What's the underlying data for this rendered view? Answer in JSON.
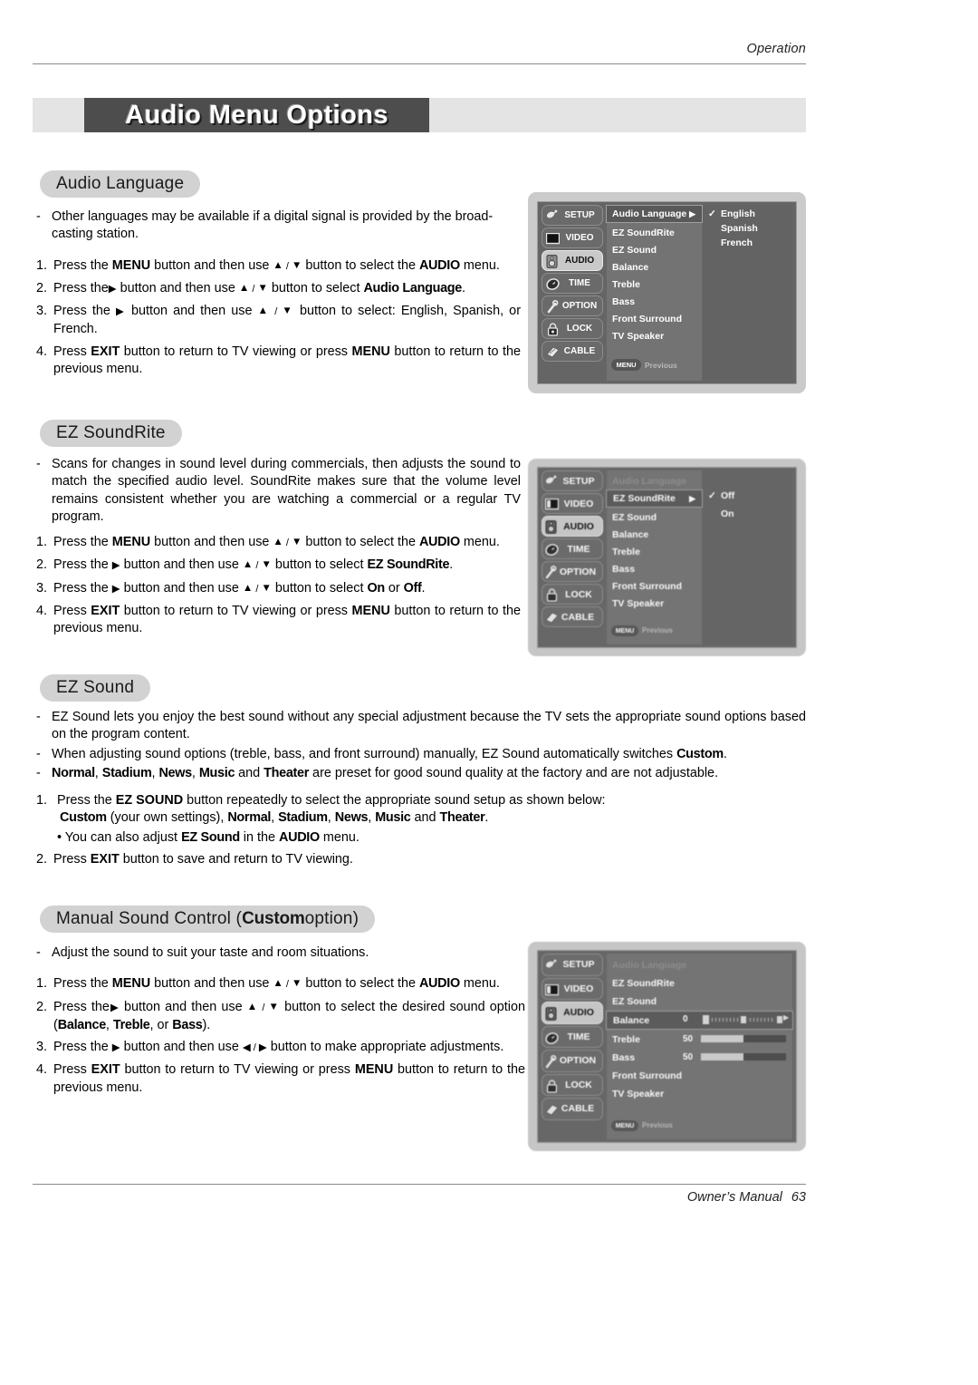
{
  "header": {
    "running_head": "Operation"
  },
  "title_banner": {
    "text": "Audio Menu Options"
  },
  "footer": {
    "manual_label": "Owner’s Manual",
    "page_number": "63"
  },
  "colors": {
    "banner_bg": "#e4e4e4",
    "banner_dark": "#4d4d4d",
    "pill_bg": "#d2d2d2",
    "osd_frame": "#cbcbcb",
    "osd_body": "#656565",
    "osd_selected": "#c9c9c9"
  },
  "sections": [
    {
      "id": "audio-language",
      "heading": "Audio Language",
      "bullets": [
        "Other languages may be available if a digital signal is provided by the broad-casting station."
      ],
      "steps": [
        "1. Press the MENU button and then use ▲ / ▼ button to select the AUDIO menu.",
        "2. Press the ▶ button and then use ▲ / ▼ button to select Audio Language.",
        "3. Press the ▶ button and then use ▲ / ▼ button to select: English, Spanish, or French.",
        "4. Press EXIT button to return to TV viewing or press MENU button to return to the previous menu."
      ]
    },
    {
      "id": "ez-soundrite",
      "heading": "EZ SoundRite",
      "bullets": [
        "Scans for changes in sound level during commercials, then adjusts the sound to match the specified audio level. SoundRite makes sure that the volume level remains consistent whether you are watching a commercial or a regular TV program."
      ],
      "steps": [
        "1. Press the MENU button and then use ▲ / ▼ button to select the AUDIO menu.",
        "2. Press the ▶ button and then use ▲ / ▼ button to select EZ SoundRite.",
        "3. Press the ▶ button and then use ▲ / ▼ button to select On or Off.",
        "4. Press EXIT button to return to TV viewing or press MENU button to return to the previous menu."
      ]
    },
    {
      "id": "ez-sound",
      "heading": "EZ Sound",
      "bullets": [
        "EZ Sound lets you enjoy the best sound without any special adjustment because the TV sets the appropriate sound options based on the program content.",
        "When adjusting sound options (treble, bass, and front surround) manually, EZ Sound automatically switches Custom.",
        "Normal, Stadium, News, Music and Theater are preset for good sound quality at the factory and are not adjustable."
      ],
      "steps": [
        "1.  Press the EZ SOUND button repeatedly to select the appropriate sound setup as shown below:",
        "Custom (your own settings), Normal, Stadium, News, Music and Theater.",
        "• You can also adjust EZ Sound in the AUDIO menu.",
        "2. Press EXIT button to save and return to TV viewing."
      ]
    },
    {
      "id": "manual-sound-control",
      "heading": "Manual Sound Control (Custom option)",
      "heading_plain": "Manual Sound Control (",
      "heading_bold": "Custom",
      "heading_tail": " option)",
      "bullets": [
        "Adjust the sound to suit your taste and room situations."
      ],
      "steps": [
        "1. Press the MENU button and then use ▲ / ▼ button to select the AUDIO menu.",
        "2. Press the ▶ button and then use ▲ / ▼ button to select the desired sound option (Balance, Treble, or Bass).",
        "3. Press the ▶ button and then use ◀ / ▶ button to make appropriate adjustments.",
        "4. Press EXIT button to return to TV viewing or press MENU button to return to the previous menu."
      ]
    }
  ],
  "osd_common": {
    "sidebar": [
      {
        "label": "SETUP",
        "icon": "satellite-dish-icon"
      },
      {
        "label": "VIDEO",
        "icon": "tv-screen-icon"
      },
      {
        "label": "AUDIO",
        "icon": "speaker-icon"
      },
      {
        "label": "TIME",
        "icon": "clock-icon"
      },
      {
        "label": "OPTION",
        "icon": "wrench-icon"
      },
      {
        "label": "LOCK",
        "icon": "padlock-icon"
      },
      {
        "label": "CABLE",
        "icon": "cable-plug-icon"
      }
    ],
    "selected_sidebar": "AUDIO",
    "menu_items": [
      "Audio Language",
      "EZ SoundRite",
      "EZ Sound",
      "Balance",
      "Treble",
      "Bass",
      "Front Surround",
      "TV Speaker"
    ],
    "footer_button": "MENU",
    "footer_label": "Previous",
    "arrow_glyph": "▶",
    "check_glyph": "✓"
  },
  "osd_screens": [
    {
      "id": "osd-audio-language",
      "highlighted_item": "Audio Language",
      "dimmed_items": [],
      "options": [
        {
          "label": "English",
          "checked": true
        },
        {
          "label": "Spanish",
          "checked": false
        },
        {
          "label": "French",
          "checked": false
        }
      ]
    },
    {
      "id": "osd-ez-soundrite",
      "highlighted_item": "EZ SoundRite",
      "dimmed_items": [
        "Audio Language"
      ],
      "options": [
        {
          "label": "Off",
          "checked": true
        },
        {
          "label": "On",
          "checked": false
        }
      ]
    },
    {
      "id": "osd-manual-sound",
      "highlighted_item": "Balance",
      "dimmed_items": [
        "Audio Language"
      ],
      "options": [],
      "sliders": [
        {
          "name": "Balance",
          "value": "0",
          "type": "balance"
        },
        {
          "name": "Treble",
          "value": "50",
          "type": "bar",
          "percent": 50
        },
        {
          "name": "Bass",
          "value": "50",
          "type": "bar",
          "percent": 50
        }
      ]
    }
  ]
}
